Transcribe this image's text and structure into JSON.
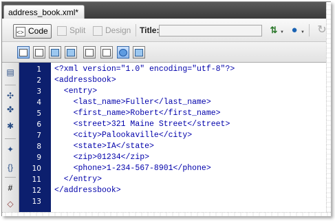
{
  "document_tab": {
    "label": "address_book.xml*"
  },
  "doc_toolbar": {
    "code_label": "Code",
    "split_label": "Split",
    "design_label": "Design",
    "title_label": "Title:",
    "title_value": ""
  },
  "gutter": {
    "line_numbers": [
      "1",
      "2",
      "3",
      "4",
      "5",
      "6",
      "7",
      "8",
      "9",
      "10",
      "11",
      "12",
      "13"
    ]
  },
  "code": {
    "lines": [
      "<?xml version=\"1.0\" encoding=\"utf-8\"?>",
      "<addressbook>",
      "  <entry>",
      "    <last_name>Fuller</last_name>",
      "    <first_name>Robert</first_name>",
      "    <street>321 Maine Street</street>",
      "    <city>Palookaville</city>",
      "    <state>IA</state>",
      "    <zip>01234</zip>",
      "    <phone>1-234-567-8901</phone>",
      "  </entry>",
      "</addressbook>",
      ""
    ],
    "text_color": "#0000aa",
    "gutter_color": "#0c1f6e"
  },
  "icons": {
    "code_view": "code-view-icon",
    "split_view": "split-view-icon",
    "design_view": "design-view-icon",
    "file_management": "file-management-icon",
    "preview": "preview-browser-icon",
    "refresh": "refresh-icon"
  }
}
